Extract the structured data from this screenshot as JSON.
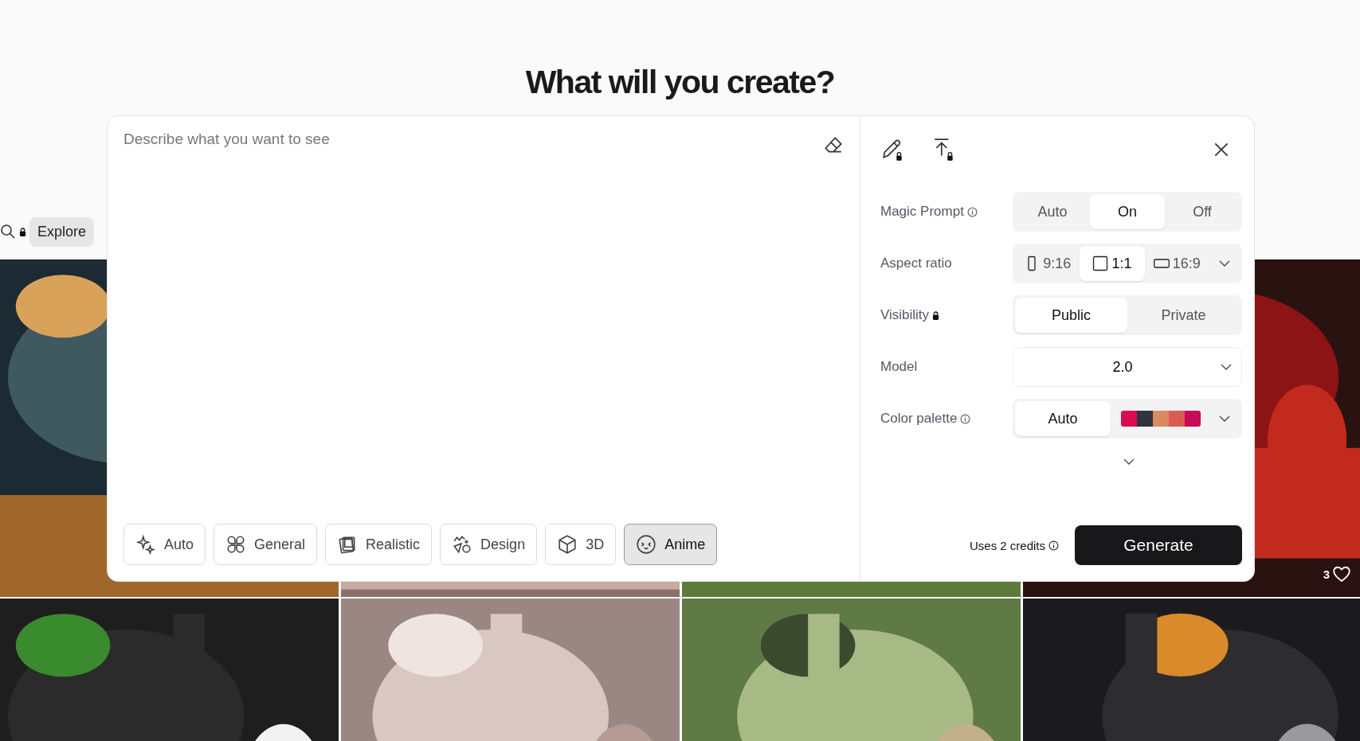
{
  "title": "What will you create?",
  "nav": {
    "items": [
      {
        "label": "Explore",
        "selected": true
      }
    ]
  },
  "gallery": [
    {
      "kind": "picture"
    },
    {
      "kind": "picture"
    },
    {
      "kind": "picture"
    },
    {
      "kind": "picture",
      "likes": "3"
    },
    {
      "kind": "picture"
    },
    {
      "kind": "picture"
    },
    {
      "kind": "picture"
    },
    {
      "kind": "picture"
    }
  ],
  "prompt": {
    "placeholder": "Describe what you want to see"
  },
  "styles": [
    {
      "label": "Auto",
      "kind": "sparkle",
      "selected": false
    },
    {
      "label": "General",
      "kind": "clover",
      "selected": false
    },
    {
      "label": "Realistic",
      "kind": "photos",
      "selected": false
    },
    {
      "label": "Design",
      "kind": "shapes",
      "selected": false
    },
    {
      "label": "3D",
      "kind": "cube",
      "selected": false
    },
    {
      "label": "Anime",
      "kind": "face",
      "selected": true
    }
  ],
  "settings": {
    "magic_prompt": {
      "label": "Magic Prompt",
      "options": [
        {
          "label": "Auto",
          "selected": false
        },
        {
          "label": "On",
          "selected": true
        },
        {
          "label": "Off",
          "selected": false
        }
      ]
    },
    "aspect_ratio": {
      "label": "Aspect ratio",
      "options": [
        {
          "label": "9:16",
          "kind": "portrait",
          "selected": false
        },
        {
          "label": "1:1",
          "kind": "square",
          "selected": true
        },
        {
          "label": "16:9",
          "kind": "landscape",
          "selected": false
        }
      ]
    },
    "visibility": {
      "label": "Visibility",
      "options": [
        {
          "label": "Public",
          "selected": true
        },
        {
          "label": "Private",
          "selected": false
        }
      ]
    },
    "model": {
      "label": "Model",
      "value": "2.0"
    },
    "color_palette": {
      "label": "Color palette",
      "auto": {
        "label": "Auto",
        "selected": true
      },
      "colors": [
        {
          "color": "#d90b52"
        },
        {
          "color": "#2f3340"
        },
        {
          "color": "#d98a5f"
        },
        {
          "color": "#d95b52"
        },
        {
          "color": "#c70a5a"
        }
      ]
    }
  },
  "credits": "Uses 2 credits",
  "generate": "Generate"
}
